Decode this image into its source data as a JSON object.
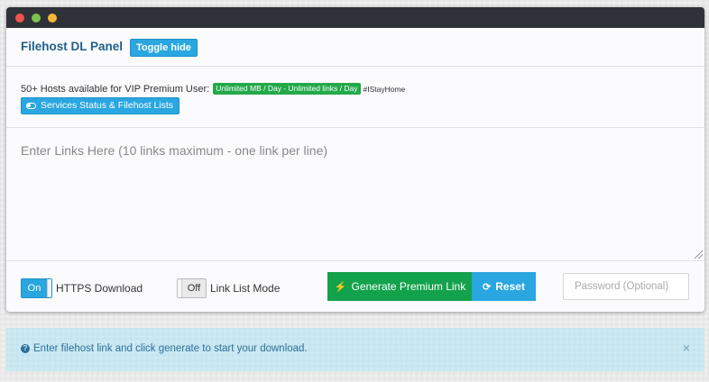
{
  "panel": {
    "title": "Filehost DL Panel",
    "toggle_label": "Toggle hide"
  },
  "info": {
    "hosts_text": "50+ Hosts available for VIP Premium User:",
    "badge": "Unlimited MB / Day - Unlimited links / Day",
    "hashtag": "#IStayHome",
    "services_button": "Services Status & Filehost Lists",
    "services_icon": "toggle-icon"
  },
  "links": {
    "placeholder": "Enter Links Here (10 links maximum - one link per line)"
  },
  "controls": {
    "https_switch": "On",
    "https_label": "HTTPS Download",
    "linklist_switch": "Off",
    "linklist_label": "Link List Mode",
    "generate_icon": "⚡",
    "generate_label": "Generate Premium Link",
    "reset_icon": "⟳",
    "reset_label": "Reset",
    "password_placeholder": "Password (Optional)"
  },
  "alert": {
    "icon": "?",
    "message": "Enter filehost link and click generate to start your download.",
    "close": "×"
  },
  "colors": {
    "accent_blue": "#2aa6e0",
    "success_green": "#12a24b",
    "badge_green": "#23a94a",
    "titlebar": "#2f3238",
    "alert_bg": "#cdeaf3"
  }
}
